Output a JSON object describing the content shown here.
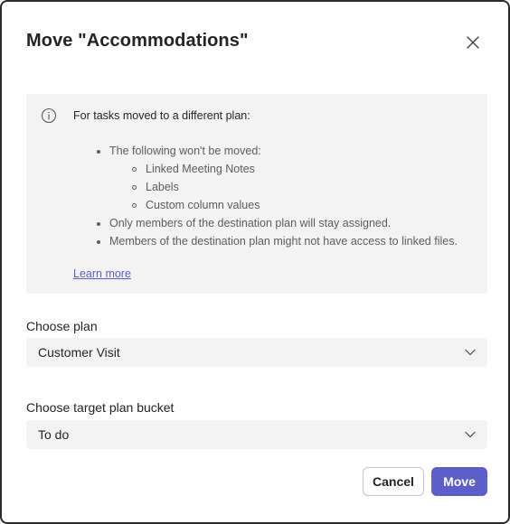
{
  "dialog": {
    "title": "Move \"Accommodations\"",
    "close_icon": "close-icon"
  },
  "info": {
    "icon": "info-icon",
    "heading": "For tasks moved to a different plan:",
    "items": [
      {
        "text": "The following won't be moved:",
        "subitems": [
          "Linked Meeting Notes",
          "Labels",
          "Custom column values"
        ]
      },
      {
        "text": "Only members of the destination plan will stay assigned."
      },
      {
        "text": "Members of the destination plan might not have access to linked files."
      }
    ],
    "learn_more": "Learn more"
  },
  "plan": {
    "label": "Choose plan",
    "value": "Customer Visit",
    "icon": "chevron-down-icon"
  },
  "bucket": {
    "label": "Choose target plan bucket",
    "value": "To do",
    "icon": "chevron-down-icon"
  },
  "buttons": {
    "cancel": "Cancel",
    "move": "Move"
  },
  "colors": {
    "accent": "#5b5fc7",
    "info_background": "#f3f3f3",
    "field_background": "#f3f3f3"
  }
}
